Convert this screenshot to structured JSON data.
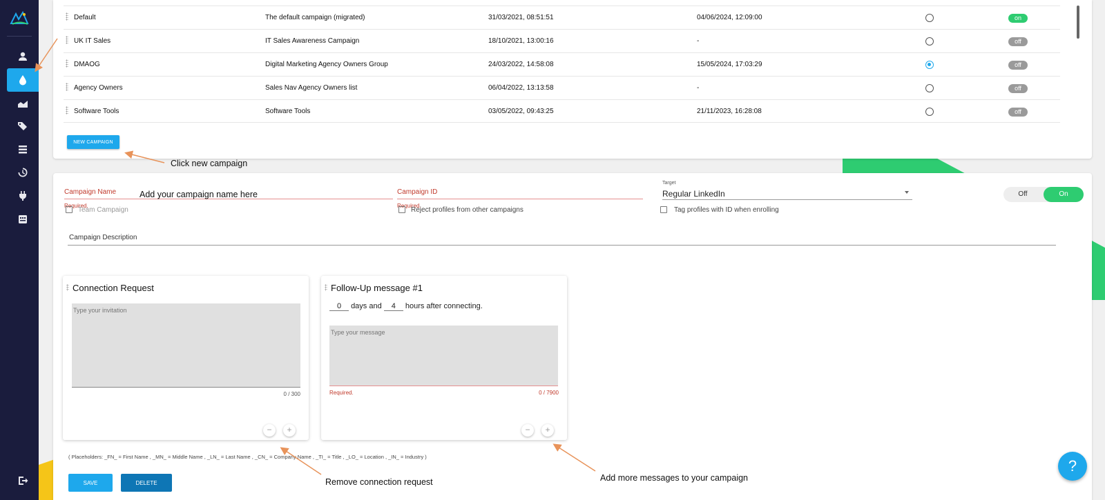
{
  "colors": {
    "accent": "#1ea8ec",
    "sidebar": "#1a1c3d",
    "on": "#2ecc71",
    "off": "#9a9a9a",
    "error": "#c0392b",
    "annotation_arrow": "#e8935a"
  },
  "sidebar": {
    "items": [
      {
        "icon": "user-icon"
      },
      {
        "icon": "drop-icon",
        "active": true
      },
      {
        "icon": "chart-icon"
      },
      {
        "icon": "tags-icon"
      },
      {
        "icon": "list-icon"
      },
      {
        "icon": "history-icon"
      },
      {
        "icon": "plug-icon"
      },
      {
        "icon": "store-icon"
      }
    ],
    "logout_icon": "logout-icon"
  },
  "campaigns": [
    {
      "name": "Default",
      "description": "The default campaign (migrated)",
      "created": "31/03/2021, 08:51:51",
      "updated": "04/06/2024, 12:09:00",
      "selected": false,
      "status": "on"
    },
    {
      "name": "UK IT Sales",
      "description": "IT Sales Awareness Campaign",
      "created": "18/10/2021, 13:00:16",
      "updated": "-",
      "selected": false,
      "status": "off"
    },
    {
      "name": "DMAOG",
      "description": "Digital Marketing Agency Owners Group",
      "created": "24/03/2022, 14:58:08",
      "updated": "15/05/2024, 17:03:29",
      "selected": true,
      "status": "off"
    },
    {
      "name": "Agency Owners",
      "description": "Sales Nav Agency Owners list",
      "created": "06/04/2022, 13:13:58",
      "updated": "-",
      "selected": false,
      "status": "off"
    },
    {
      "name": "Software Tools",
      "description": "Software Tools",
      "created": "03/05/2022, 09:43:25",
      "updated": "21/11/2023, 16:28:08",
      "selected": false,
      "status": "off"
    }
  ],
  "new_campaign_label": "NEW CAMPAIGN",
  "form": {
    "campaign_name_label": "Campaign Name",
    "campaign_id_label": "Campaign ID",
    "required": "Required.",
    "target_label": "Target",
    "target_value": "Regular LinkedIn",
    "toggle_off": "Off",
    "toggle_on": "On",
    "team_campaign": "Team Campaign",
    "reject_profiles": "Reject profiles from other campaigns",
    "tag_profiles": "Tag profiles with ID when enrolling",
    "description_label": "Campaign Description"
  },
  "connection_request": {
    "title": "Connection Request",
    "placeholder": "Type your invitation",
    "counter": "0 / 300"
  },
  "follow_up": {
    "title": "Follow-Up message #1",
    "days": "0",
    "days_text": "days and",
    "hours": "4",
    "hours_text": "hours after connecting.",
    "placeholder": "Type your message",
    "required": "Required.",
    "counter": "0 / 7900"
  },
  "placeholders_text": "( Placeholders: _FN_ = First Name , _MN_ = Middle Name , _LN_ = Last Name , _CN_ = Company Name , _TI_ = Title , _LO_ = Location , _IN_ = Industry )",
  "buttons": {
    "save": "SAVE",
    "delete": "DELETE",
    "help": "?"
  },
  "annotations": {
    "new_campaign": "Click new campaign",
    "campaign_name": "Add your campaign name here",
    "remove_connection": "Remove connection request",
    "add_messages": "Add more messages to your campaign"
  }
}
